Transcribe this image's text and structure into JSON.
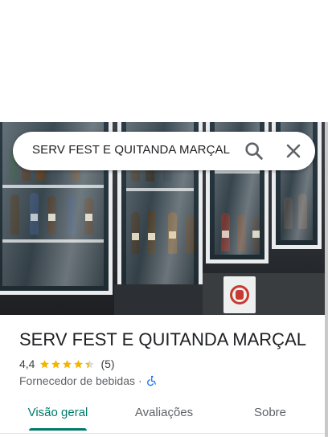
{
  "search": {
    "query": "SERV FEST E QUITANDA MARÇAL"
  },
  "place": {
    "name": "SERV FEST E QUITANDA MARÇAL",
    "rating": "4,4",
    "rating_value": 4.4,
    "review_count": "(5)",
    "category": "Fornecedor de bebidas",
    "separator": "·"
  },
  "icons": {
    "search": "search-icon",
    "close": "close-icon",
    "star": "star-icon",
    "accessibility": "wheelchair-accessible-icon"
  },
  "tabs": [
    {
      "label": "Visão geral",
      "active": true
    },
    {
      "label": "Avaliações",
      "active": false
    },
    {
      "label": "Sobre",
      "active": false
    }
  ],
  "colors": {
    "accent": "#00796b",
    "star": "#f4b400",
    "accessibility": "#1a73e8"
  }
}
